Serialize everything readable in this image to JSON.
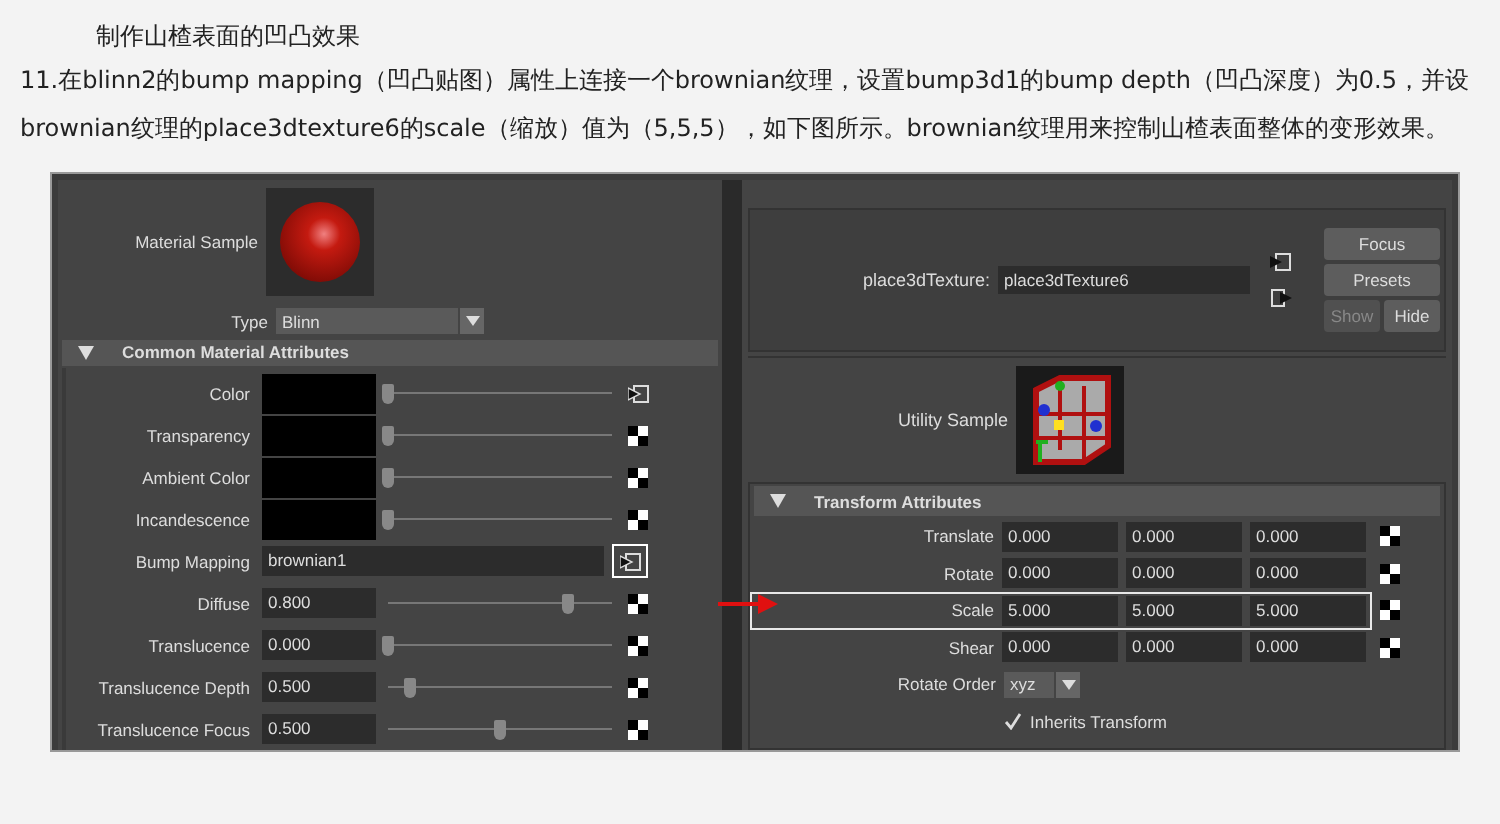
{
  "heading": "制作山楂表面的凹凸效果",
  "paragraph": "11.在blinn2的bump mapping（凹凸贴图）属性上连接一个brownian纹理，设置bump3d1的bump depth（凹凸深度）为0.5，并设brownian纹理的place3dtexture6的scale（缩放）值为（5,5,5），如下图所示。brownian纹理用来控制山楂表面整体的变形效果。",
  "material_panel": {
    "sample_label": "Material Sample",
    "type_label": "Type",
    "type_value": "Blinn",
    "section": {
      "title": "Common Material Attributes",
      "expanded": true
    },
    "rows": [
      {
        "kind": "color",
        "label": "Color",
        "level": 0,
        "highlighted": false
      },
      {
        "kind": "color",
        "label": "Transparency",
        "level": 0,
        "highlighted": false
      },
      {
        "kind": "color",
        "label": "Ambient Color",
        "level": 0,
        "highlighted": false
      },
      {
        "kind": "color",
        "label": "Incandescence",
        "level": 0,
        "highlighted": false
      },
      {
        "kind": "map",
        "label": "Bump Mapping",
        "value": "brownian1",
        "highlighted": true
      },
      {
        "kind": "value",
        "label": "Diffuse",
        "value": "0.800",
        "level": 0.8,
        "highlighted": false
      },
      {
        "kind": "value",
        "label": "Translucence",
        "value": "0.000",
        "level": 0,
        "highlighted": false
      },
      {
        "kind": "value",
        "label": "Translucence Depth",
        "value": "0.500",
        "level": 0.1,
        "highlighted": false
      },
      {
        "kind": "value",
        "label": "Translucence Focus",
        "value": "0.500",
        "level": 0.5,
        "highlighted": false
      }
    ]
  },
  "texture_panel": {
    "node_label": "place3dTexture:",
    "node_value": "place3dTexture6",
    "buttons": [
      {
        "label": "Focus",
        "disabled": false
      },
      {
        "label": "Presets",
        "disabled": false
      },
      {
        "label": "Show",
        "disabled": true
      },
      {
        "label": "Hide",
        "disabled": false
      }
    ],
    "sample_label": "Utility Sample",
    "section": {
      "title": "Transform Attributes",
      "expanded": true
    },
    "rows": [
      {
        "kind": "vector",
        "label": "Translate",
        "values": [
          "0.000",
          "0.000",
          "0.000"
        ],
        "highlighted": false
      },
      {
        "kind": "vector",
        "label": "Rotate",
        "values": [
          "0.000",
          "0.000",
          "0.000"
        ],
        "highlighted": false
      },
      {
        "kind": "vector",
        "label": "Scale",
        "values": [
          "5.000",
          "5.000",
          "5.000"
        ],
        "highlighted": true
      },
      {
        "kind": "vector",
        "label": "Shear",
        "values": [
          "0.000",
          "0.000",
          "0.000"
        ],
        "highlighted": false
      },
      {
        "kind": "dropdown",
        "label": "Rotate Order",
        "value": "xyz"
      },
      {
        "kind": "checkbox",
        "label": "Inherits Transform",
        "checked": true
      }
    ]
  }
}
